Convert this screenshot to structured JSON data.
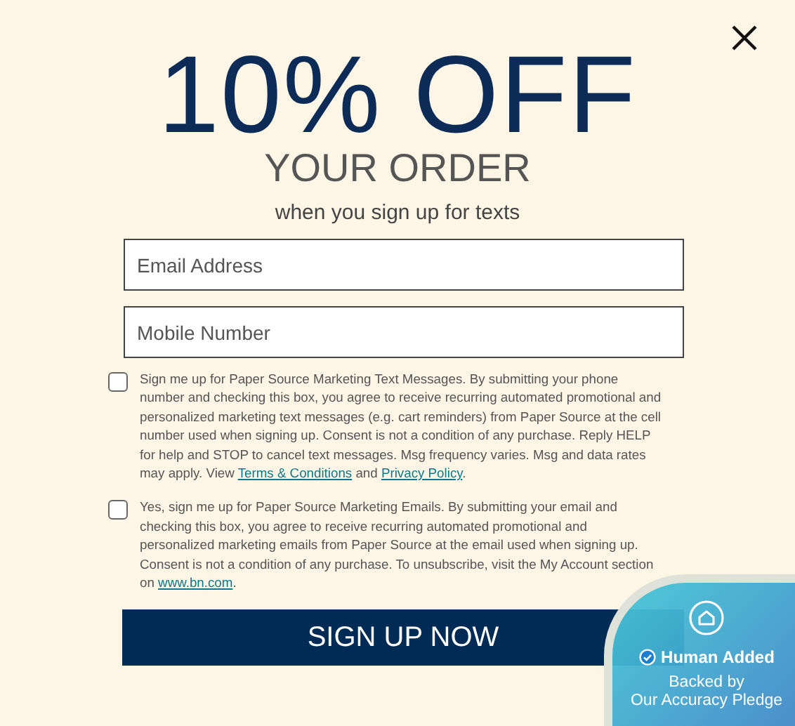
{
  "headline": "10% OFF",
  "subheadline": "YOUR ORDER",
  "tagline": "when you sign up for texts",
  "fields": [
    {
      "placeholder": "Email Address"
    },
    {
      "placeholder": "Mobile Number"
    }
  ],
  "consents": [
    {
      "checked": false,
      "parts": [
        {
          "kind": "text",
          "text": "Sign me up for Paper Source Marketing Text Messages. By submitting your phone number and checking this box, you agree to receive recurring automated promotional and personalized marketing text messages (e.g. cart reminders) from Paper Source at the cell number used when signing up. Consent is not a condition of any purchase. Reply HELP for help and STOP to cancel text messages. Msg frequency varies. Msg and data rates may apply. View "
        },
        {
          "kind": "link",
          "text": "Terms & Conditions"
        },
        {
          "kind": "text",
          "text": " and "
        },
        {
          "kind": "link",
          "text": "Privacy Policy"
        },
        {
          "kind": "text",
          "text": "."
        }
      ]
    },
    {
      "checked": false,
      "parts": [
        {
          "kind": "text",
          "text": "Yes, sign me up for Paper Source Marketing Emails. By submitting your email and checking this box, you agree to receive recurring automated promotional and personalized marketing emails from Paper Source at the email used when signing up. Consent is not a condition of any purchase. To unsubscribe, visit the My Account section on "
        },
        {
          "kind": "link",
          "text": "www.bn.com"
        },
        {
          "kind": "text",
          "text": "."
        }
      ]
    }
  ],
  "submit": "SIGN UP NOW",
  "badge": {
    "title": "Human Added",
    "lines": [
      "Backed by",
      "Our Accuracy Pledge"
    ]
  }
}
